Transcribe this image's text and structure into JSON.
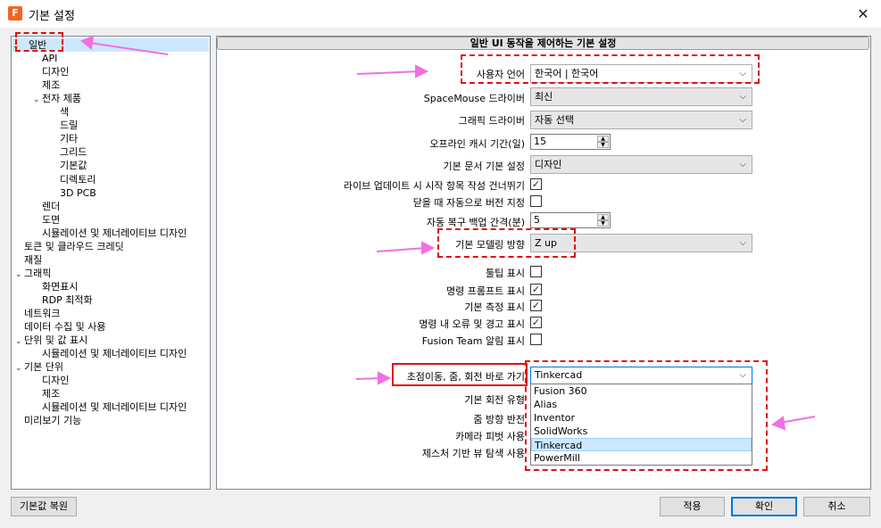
{
  "window": {
    "title": "기본 설정",
    "icon": "F"
  },
  "tree": [
    {
      "label": "일반",
      "caret": "✓",
      "selected": true
    },
    {
      "label": "API"
    },
    {
      "label": "디자인"
    },
    {
      "label": "제조"
    },
    {
      "label": "전자 제품",
      "caret": "v"
    },
    {
      "label": "색"
    },
    {
      "label": "드릴"
    },
    {
      "label": "기타"
    },
    {
      "label": "그리드"
    },
    {
      "label": "기본값"
    },
    {
      "label": "디렉토리"
    },
    {
      "label": "3D PCB"
    },
    {
      "label": "렌더"
    },
    {
      "label": "도면"
    },
    {
      "label": "시뮬레이션 및 제너레이티브 디자인"
    },
    {
      "label": "토큰 및 클라우드 크레딧"
    },
    {
      "label": "재질"
    },
    {
      "label": "그래픽",
      "caret": "v"
    },
    {
      "label": "화면표시"
    },
    {
      "label": "RDP 최적화"
    },
    {
      "label": "네트워크"
    },
    {
      "label": "데이터 수집 및 사용"
    },
    {
      "label": "단위 및 값 표시",
      "caret": "v"
    },
    {
      "label": "시뮬레이션 및 제너레이티브 디자인"
    },
    {
      "label": "기본 단위",
      "caret": "v"
    },
    {
      "label": "디자인"
    },
    {
      "label": "제조"
    },
    {
      "label": "시뮬레이션 및 제너레이티브 디자인"
    },
    {
      "label": "미리보기 기능"
    }
  ],
  "panel": {
    "header": "일반 UI 동작을 제어하는 기본 설정",
    "settings": {
      "language": {
        "label": "사용자 언어",
        "value": "한국어 | 한국어"
      },
      "spacemouse": {
        "label": "SpaceMouse 드라이버",
        "value": "최신"
      },
      "graphics": {
        "label": "그래픽 드라이버",
        "value": "자동 선택"
      },
      "offline_cache": {
        "label": "오프라인 캐시 기간(일)",
        "value": "15"
      },
      "default_doc": {
        "label": "기본 문서 기본 설정",
        "value": "디자인"
      },
      "skip_live_update": {
        "label": "라이브 업데이트 시 시작 항목 작성 건너뛰기",
        "checked": true
      },
      "auto_version": {
        "label": "닫을 때 자동으로 버전 지정",
        "checked": false
      },
      "autosave": {
        "label": "자동 복구 백업 간격(분)",
        "value": "5"
      },
      "modeling_dir": {
        "label": "기본 모델링 방향",
        "value": "Z up"
      },
      "tooltips": {
        "label": "툴팁 표시",
        "checked": false
      },
      "cmd_prompt": {
        "label": "명령 프롬프트 표시",
        "checked": true
      },
      "measure": {
        "label": "기본 측정 표시",
        "checked": true
      },
      "errors": {
        "label": "명령 내 오류 및 경고 표시",
        "checked": true
      },
      "fusion_team": {
        "label": "Fusion Team 알림 표시",
        "checked": false
      },
      "pan_zoom": {
        "label": "초점이동, 줌, 회전 바로 가기",
        "value": "Tinkercad"
      },
      "orbit_type": {
        "label": "기본 회전 유형"
      },
      "zoom_dir": {
        "label": "줌 방향 반전"
      },
      "camera_pivot": {
        "label": "카메라 피벗 사용"
      },
      "gesture_nav": {
        "label": "제스처 기반 뷰 탐색 사용"
      }
    },
    "pan_zoom_options": [
      "Fusion 360",
      "Alias",
      "Inventor",
      "SolidWorks",
      "Tinkercad",
      "PowerMill"
    ],
    "highlighted_option": "Tinkercad"
  },
  "buttons": {
    "restore": "기본값 복원",
    "apply": "적용",
    "ok": "확인",
    "cancel": "취소"
  },
  "colors": {
    "annotation_red": "#e01010",
    "annotation_arrow": "#f070e0",
    "selection": "#cce8ff"
  }
}
